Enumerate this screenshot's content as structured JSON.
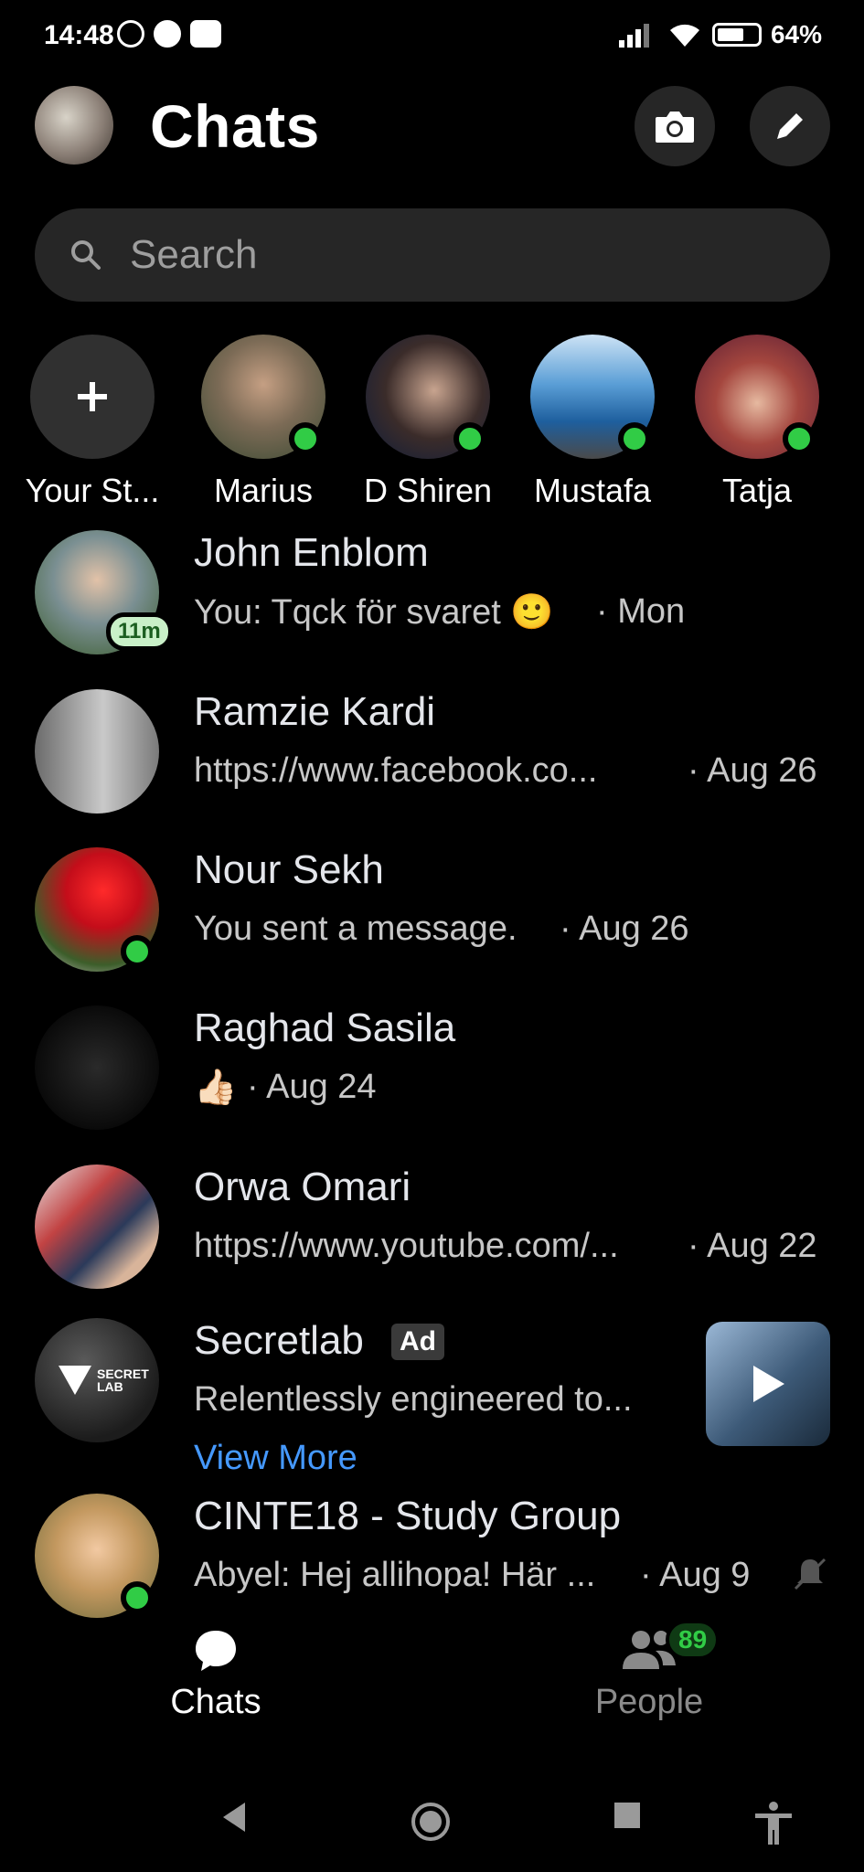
{
  "status": {
    "time": "14:48",
    "battery": "64%",
    "left_icons": [
      "alarm-icon",
      "office-365-icon",
      "youtube-icon"
    ],
    "right_icons": [
      "signal-icon",
      "wifi-icon",
      "battery-icon"
    ]
  },
  "header": {
    "title": "Chats",
    "camera_icon": "camera-icon",
    "edit_icon": "edit-icon"
  },
  "search": {
    "placeholder": "Search"
  },
  "stories": [
    {
      "name": "Your St...",
      "add": true
    },
    {
      "name": "Marius",
      "online": true
    },
    {
      "name": "D Shiren",
      "online": true
    },
    {
      "name": "Mustafa",
      "online": true
    },
    {
      "name": "Tatja",
      "online": true
    }
  ],
  "chats": [
    {
      "name": "John Enblom",
      "preview": "You: Tqck för svaret 🙂",
      "time": "· Mon",
      "active": "11m"
    },
    {
      "name": "Ramzie Kardi",
      "preview": "https://www.facebook.co...",
      "time": "· Aug 26"
    },
    {
      "name": "Nour Sekh",
      "preview": "You sent a message.",
      "time": "· Aug 26",
      "online": true
    },
    {
      "name": "Raghad Sasila",
      "preview": "👍🏻",
      "time": "· Aug 24"
    },
    {
      "name": "Orwa Omari",
      "preview": "https://www.youtube.com/...",
      "time": "· Aug 22"
    },
    {
      "name": "Secretlab",
      "ad_label": "Ad",
      "preview": "Relentlessly engineered to...",
      "link": "View More",
      "logo_text": "SECRET LAB"
    },
    {
      "name": "CINTE18 - Study Group",
      "preview": "Abyel: Hej allihopa! Här ...",
      "time": "· Aug 9",
      "online": true,
      "muted": true
    }
  ],
  "nav": {
    "chats_label": "Chats",
    "people_label": "People",
    "people_count": "89"
  },
  "colors": {
    "background": "#000000",
    "online": "#31cc46",
    "link": "#4599ff",
    "surface": "#262626"
  }
}
